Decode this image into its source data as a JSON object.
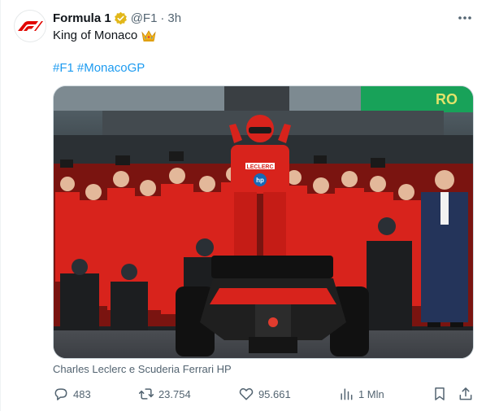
{
  "author": {
    "name": "Formula 1",
    "handle": "@F1",
    "separator": "·",
    "time": "3h"
  },
  "tweet": {
    "text": "King of Monaco",
    "emoji": "crown-emoji",
    "hashtags": [
      "#F1",
      "#MonacoGP"
    ]
  },
  "media": {
    "caption": "Charles Leclerc e Scuderia Ferrari HP",
    "car_number_label": "LECLERC",
    "sponsor_label": "hp",
    "banner_label": "RO"
  },
  "actions": {
    "replies": "483",
    "reposts": "23.754",
    "likes": "95.661",
    "views": "1 Mln"
  },
  "colors": {
    "accent": "#1d9bf0",
    "muted": "#536471",
    "ferrari_red": "#d8231c",
    "verified_gold": "#e2b719",
    "f1_red": "#e10600"
  }
}
